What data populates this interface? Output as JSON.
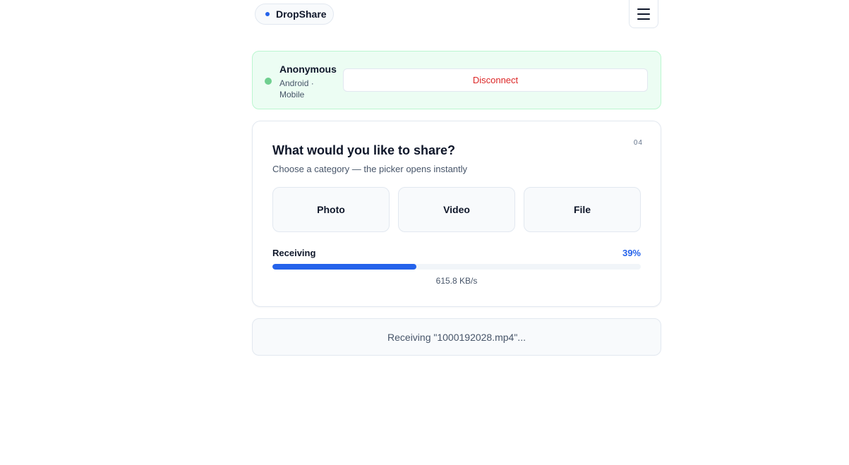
{
  "header": {
    "brand": "DropShare",
    "brand_icon": "dot-icon",
    "menu_icon": "hamburger-menu-icon"
  },
  "device": {
    "name": "Anonymous",
    "meta": "Android · Mobile",
    "status": "connected",
    "disconnect_label": "Disconnect"
  },
  "share": {
    "step": "04",
    "title": "What would you like to share?",
    "subtitle": "Choose a category — the picker opens instantly",
    "categories": [
      {
        "label": "Photo"
      },
      {
        "label": "Video"
      },
      {
        "label": "File"
      }
    ],
    "progress": {
      "label": "Receiving",
      "percent_text": "39%",
      "percent": 39,
      "speed": "615.8 KB/s"
    }
  },
  "status": {
    "message": "Receiving \"1000192028.mp4\"..."
  },
  "colors": {
    "accent": "#2563eb",
    "danger": "#dc2626",
    "connected_bg": "#ecfdf3",
    "status_dot": "#6fcf8f"
  }
}
